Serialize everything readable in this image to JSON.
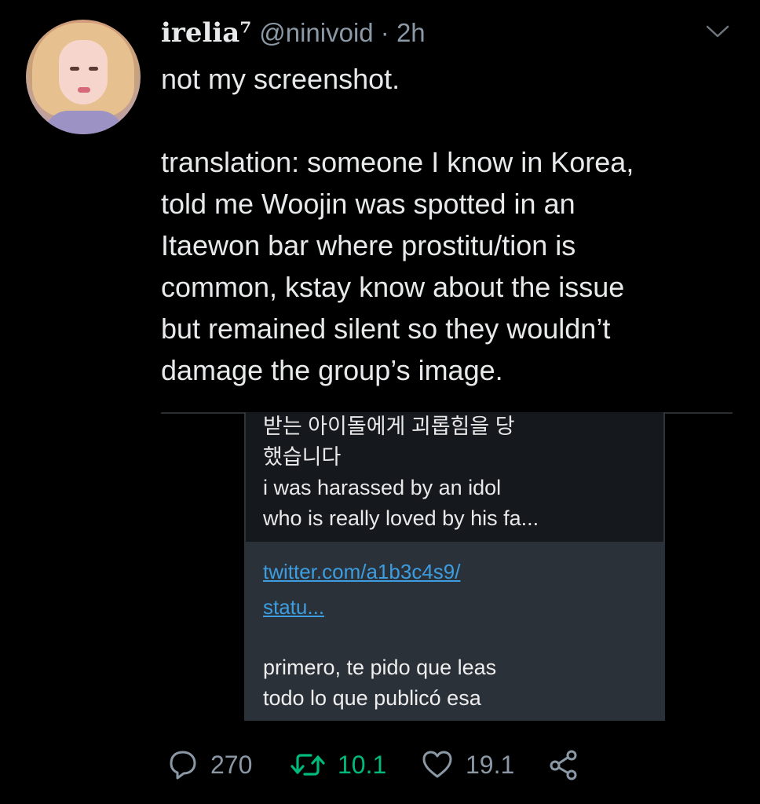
{
  "tweet": {
    "author_name": "irelia⁷",
    "meta": "@ninivoid · 2h",
    "text": "not my screenshot.\n\ntranslation: someone I know in Korea,\ntold me Woojin was spotted in an\nItaewon bar where prostitu/tion is\ncommon, kstay know about the issue\nbut remained silent so they wouldn’t\ndamage the group’s image."
  },
  "media": {
    "top_lines": [
      "받는 아이돌에게 괴롭힘을 당",
      "했습니다",
      "i was harassed by an idol",
      "who is really loved by his fa..."
    ],
    "link_lines": [
      "twitter.com/a1b3c4s9/",
      "statu..."
    ],
    "body_lines": [
      "primero, te pido que leas",
      "todo lo que publicó esa"
    ]
  },
  "actions": {
    "reply_count": "270",
    "retweet_count": "10.1",
    "like_count": "19.1"
  },
  "colors": {
    "background": "#000000",
    "text": "#e7e9ea",
    "muted": "#8b98a5",
    "retweet_active": "#00ba7c",
    "link": "#3c9de0"
  },
  "icons": [
    "chevron-down-icon",
    "reply-icon",
    "retweet-icon",
    "like-icon",
    "share-icon"
  ]
}
